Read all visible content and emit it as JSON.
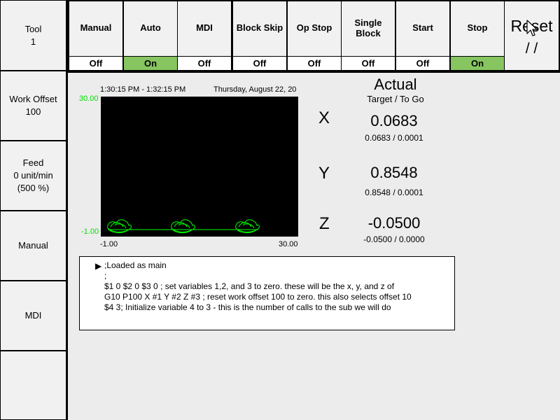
{
  "left_panel": {
    "tool": {
      "label": "Tool",
      "value": "1"
    },
    "work_offset": {
      "label": "Work Offset",
      "value": "100"
    },
    "feed": {
      "label": "Feed",
      "value": "0 unit/min",
      "percent": "(500 %)"
    },
    "manual": "Manual",
    "mdi": "MDI",
    "empty": ""
  },
  "modes": [
    {
      "label": "Manual",
      "state": "Off"
    },
    {
      "label": "Auto",
      "state": "On"
    },
    {
      "label": "MDI",
      "state": "Off"
    },
    {
      "label": "Block Skip",
      "state": "Off"
    },
    {
      "label": "Op Stop",
      "state": "Off"
    },
    {
      "label": "Single Block",
      "state": "Off"
    },
    {
      "label": "Start",
      "state": "Off"
    },
    {
      "label": "Stop",
      "state": "On"
    }
  ],
  "reset": {
    "label": "Reset",
    "status": "/ /"
  },
  "plot": {
    "time_range": "1:30:15 PM - 1:32:15 PM",
    "date": "Thursday, August 22, 20",
    "y_max": "30.00",
    "y_min": "-1.00",
    "x_min": "-1.00",
    "x_max": "30.00"
  },
  "position": {
    "title": "Actual",
    "subtitle": "Target / To Go",
    "axes": [
      {
        "name": "X",
        "actual": "0.0683",
        "target_togo": "0.0683 / 0.0001"
      },
      {
        "name": "Y",
        "actual": "0.8548",
        "target_togo": "0.8548 / 0.0001"
      },
      {
        "name": "Z",
        "actual": "-0.0500",
        "target_togo": "-0.0500 / 0.0000"
      }
    ]
  },
  "gcode": {
    "arrow": "▶",
    "lines": [
      ";Loaded as main",
      ";",
      "$1 0 $2 0 $3 0 ; set variables 1,2, and 3 to zero.  these will be the x, y, and z of",
      "G10 P100 X #1 Y #2 Z #3 ; reset work offset 100 to zero. this also selects offset 10",
      "$4 3; Initialize variable 4 to 3 - this is the number of calls to the sub we will do"
    ]
  },
  "colors": {
    "on": "#86c560",
    "off": "#ffffff",
    "plot_bg": "#000000",
    "plot_trace": "#00ff00"
  }
}
